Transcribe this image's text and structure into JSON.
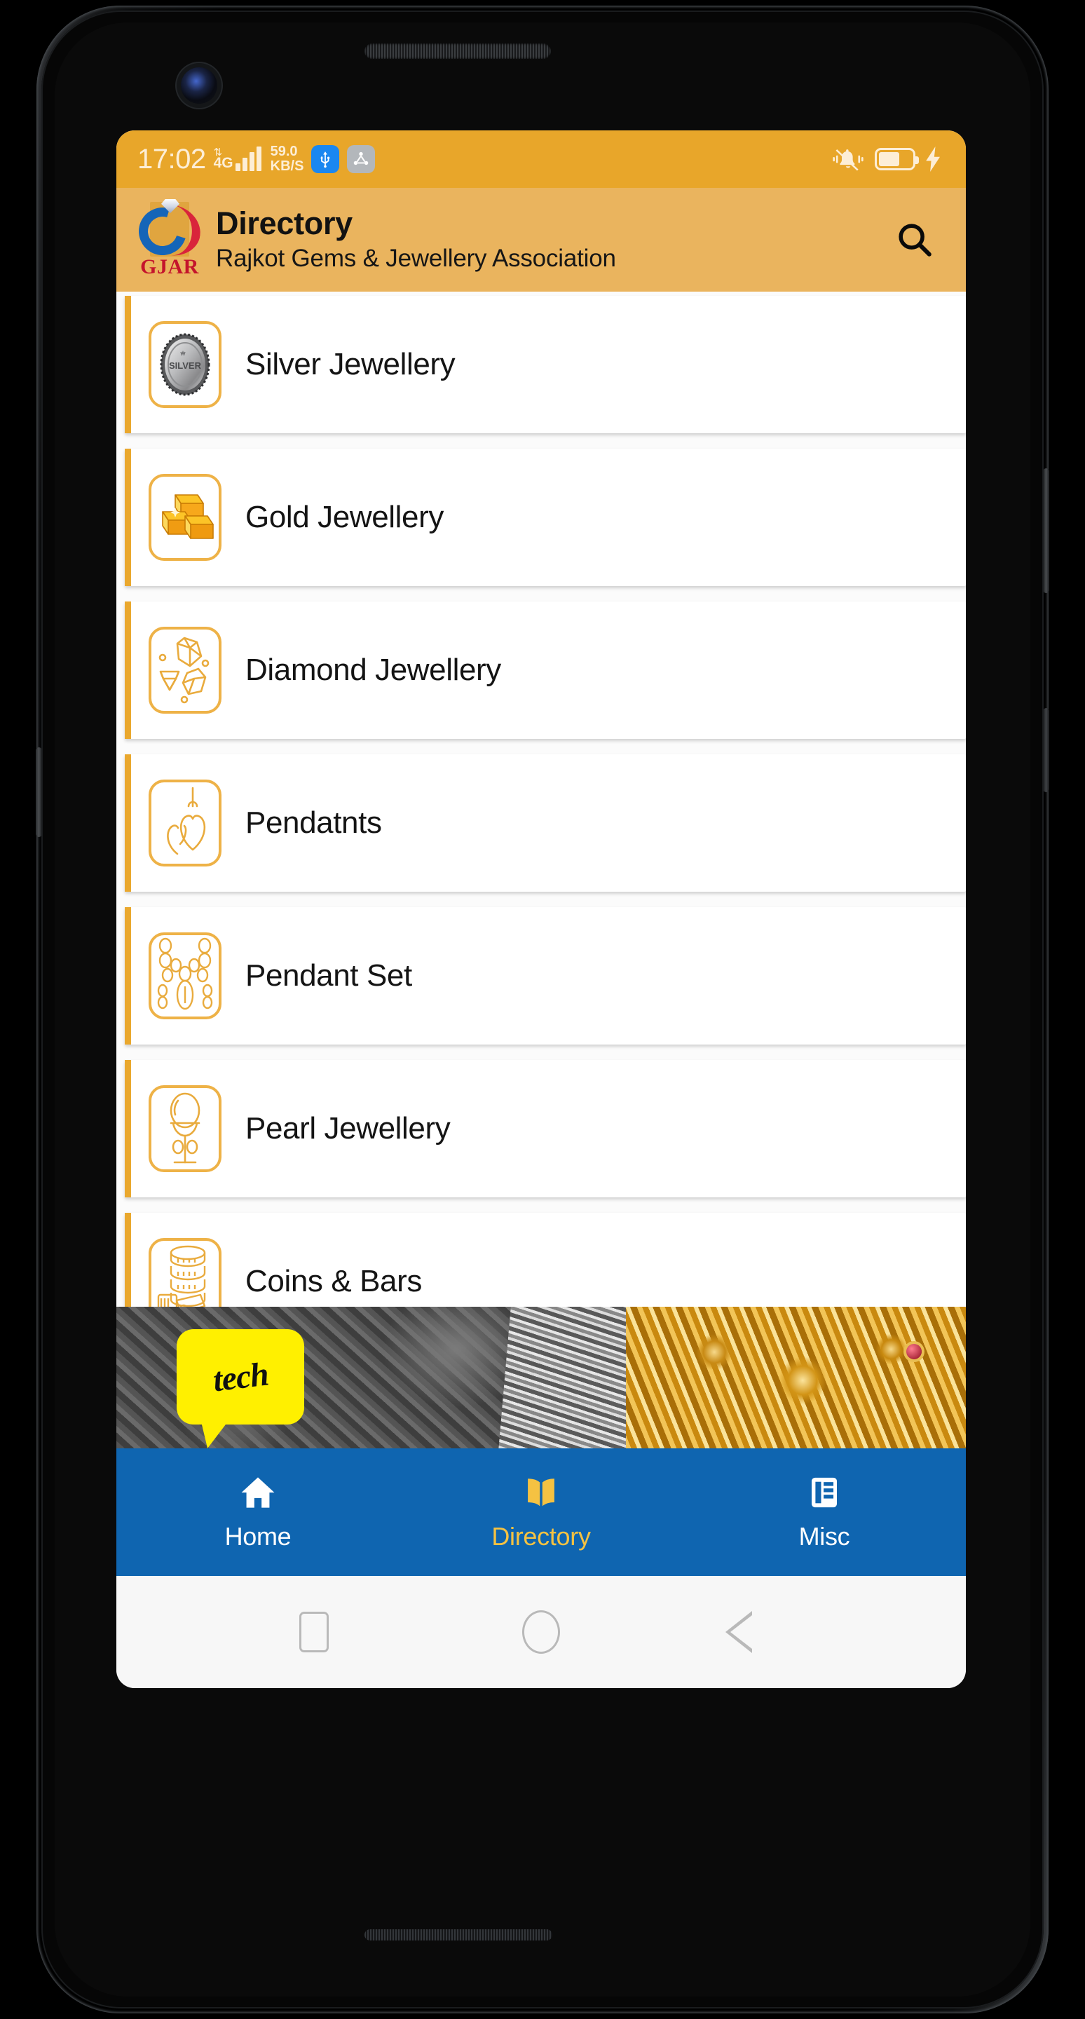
{
  "status_bar": {
    "time": "17:02",
    "network_type": "4G",
    "data_speed_value": "59.0",
    "data_speed_unit": "KB/S",
    "usb_icon": "usb-icon",
    "share_icon": "share-nodes-icon",
    "mute_icon": "bell-muted-icon",
    "battery_icon": "battery-icon",
    "battery_level_pct": 64,
    "charging_icon": "charging-bolt-icon",
    "background_color": "#E8A62A"
  },
  "app_bar": {
    "logo_name": "gjar-logo",
    "logo_text": "GJAR",
    "title": "Directory",
    "subtitle": "Rajkot Gems & Jewellery Association",
    "search_icon": "search-icon",
    "background_color": "#EAB45E"
  },
  "directory": {
    "accent_color": "#EAA82E",
    "items": [
      {
        "label": "Silver Jewellery",
        "icon": "silver-coin-icon"
      },
      {
        "label": "Gold Jewellery",
        "icon": "gold-bars-icon"
      },
      {
        "label": "Diamond Jewellery",
        "icon": "diamond-gems-icon"
      },
      {
        "label": "Pendatnts",
        "icon": "heart-pendants-icon"
      },
      {
        "label": "Pendant Set",
        "icon": "necklace-set-icon"
      },
      {
        "label": "Pearl Jewellery",
        "icon": "pearl-stand-icon"
      },
      {
        "label": "Coins & Bars",
        "icon": "coin-stack-icon"
      }
    ]
  },
  "banner_ad": {
    "name": "gtech-advertisement-banner",
    "logo_text": "tech",
    "logo_mark": "g-letter-mark"
  },
  "bottom_nav": {
    "background_color": "#0F65B0",
    "active_color": "#F5C242",
    "items": [
      {
        "label": "Home",
        "icon": "home-icon",
        "active": false
      },
      {
        "label": "Directory",
        "icon": "book-icon",
        "active": true
      },
      {
        "label": "Misc",
        "icon": "list-card-icon",
        "active": false
      }
    ]
  },
  "android_nav": {
    "recents_icon": "square-recents-icon",
    "home_icon": "circle-home-icon",
    "back_icon": "triangle-back-icon"
  }
}
